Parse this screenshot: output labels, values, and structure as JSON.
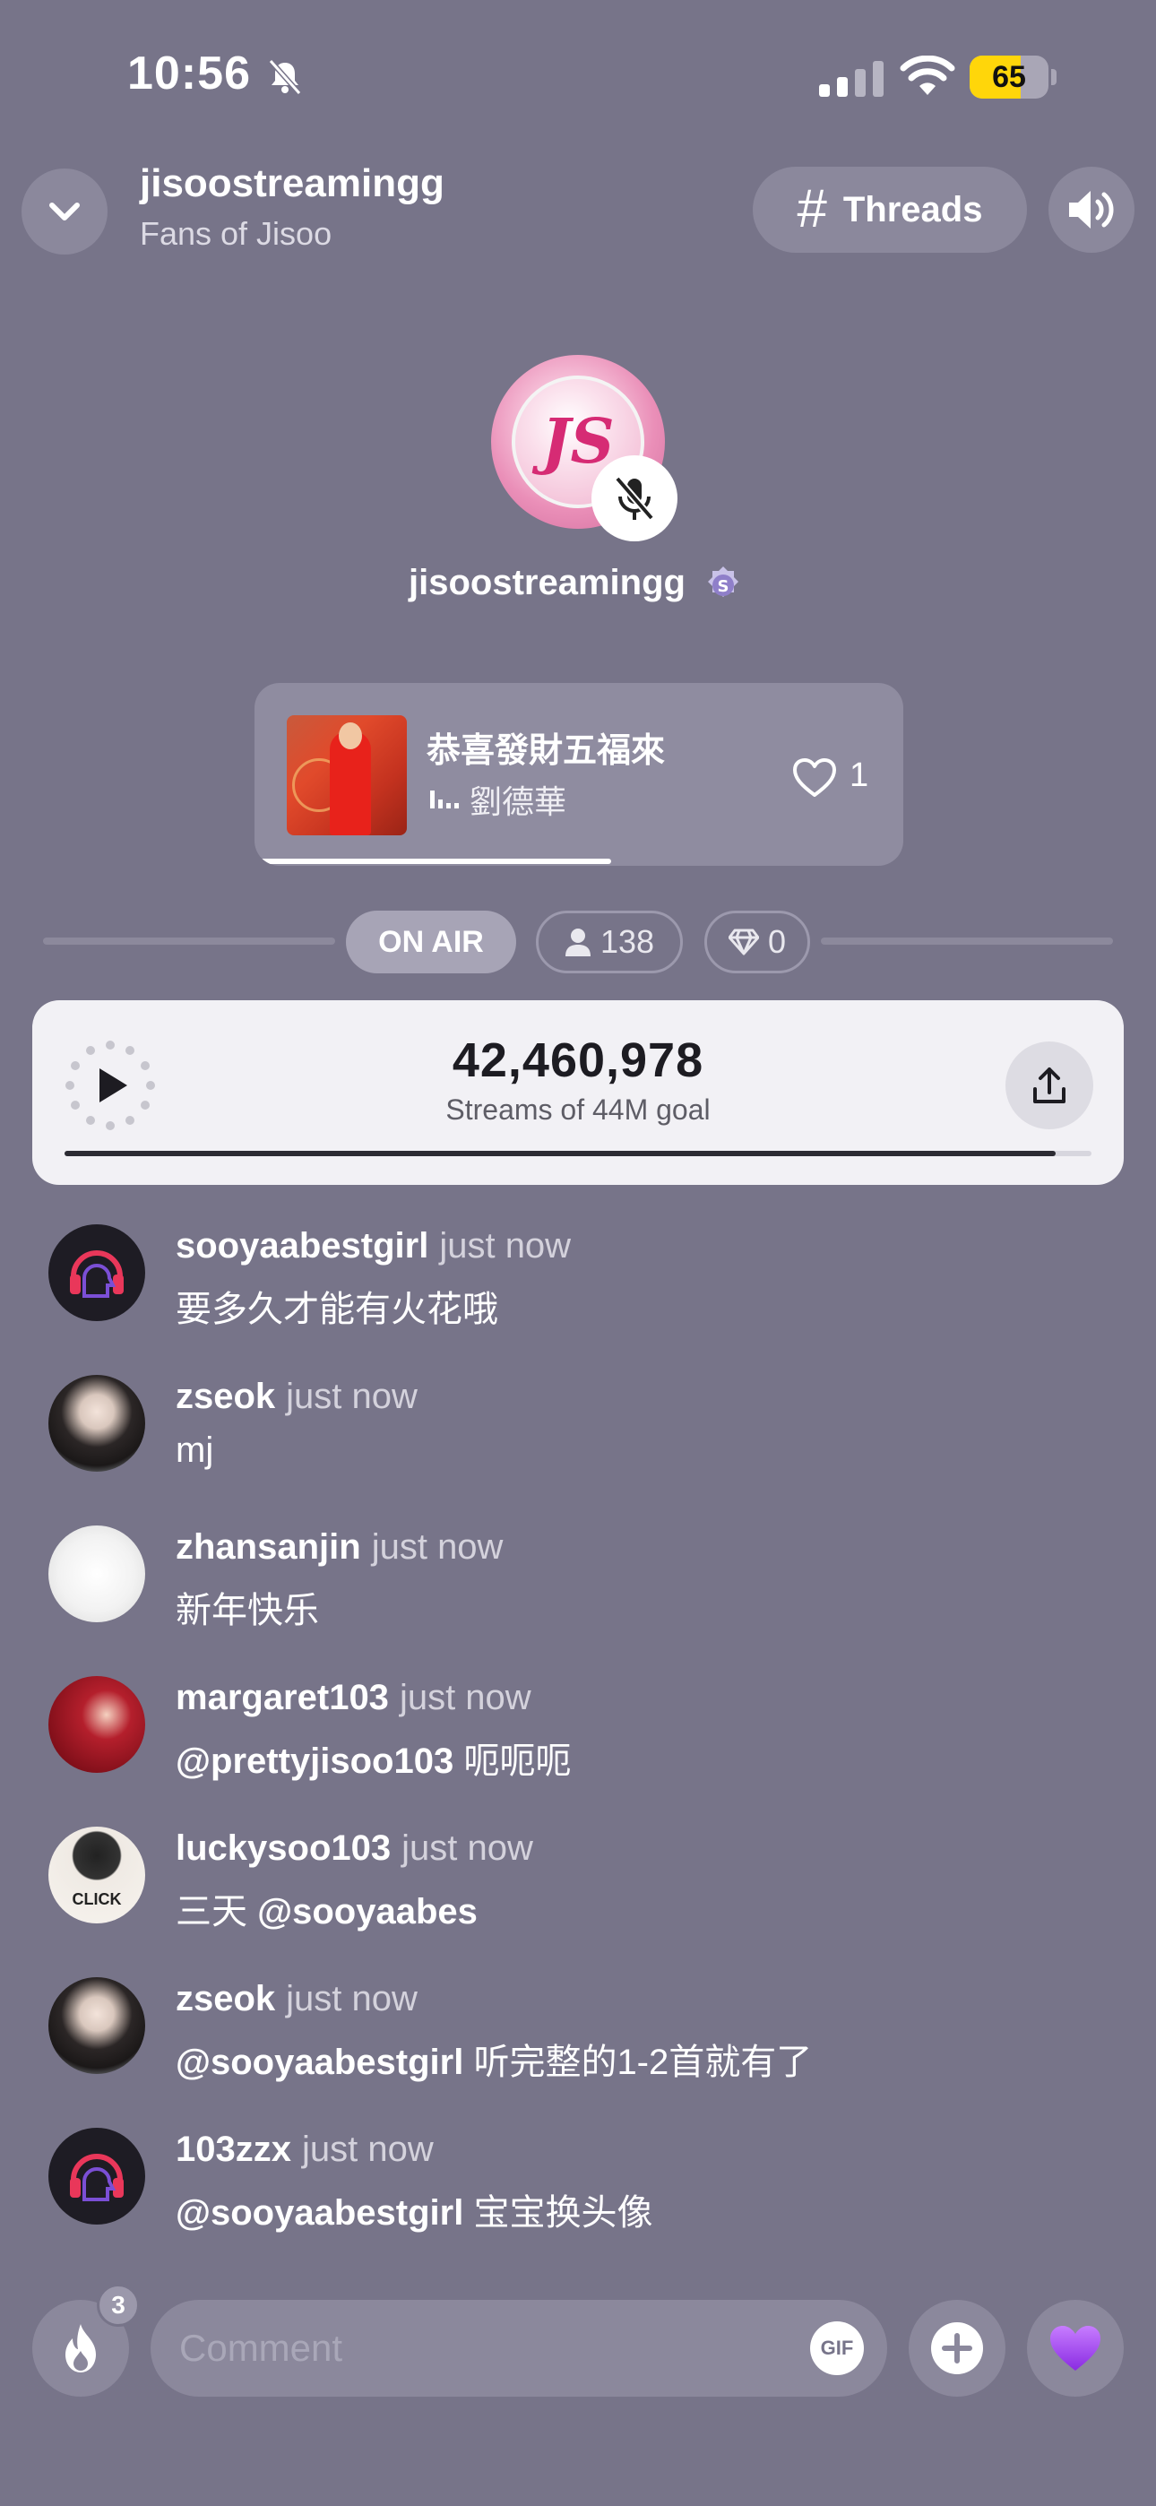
{
  "status_bar": {
    "time": "10:56",
    "battery": "65",
    "battery_level": 0.65
  },
  "header": {
    "title": "jisoostreamingg",
    "subtitle": "Fans of Jisoo",
    "threads_label": "Threads"
  },
  "host": {
    "name": "jisoostreamingg",
    "avatar_text": "JS"
  },
  "now_playing": {
    "title": "恭喜發財五福來",
    "artist": "劉德華",
    "likes": "1",
    "progress": 0.55
  },
  "room": {
    "on_air_label": "ON AIR",
    "listeners": "138",
    "gems": "0"
  },
  "stream_goal": {
    "count": "42,460,978",
    "caption": "Streams of 44M goal",
    "progress": 0.965
  },
  "chat": [
    {
      "user": "sooyaabestgirl",
      "time": "just now",
      "mention": "",
      "text": "要多久才能有火花哦"
    },
    {
      "user": "zseok",
      "time": "just now",
      "mention": "",
      "text": "mj"
    },
    {
      "user": "zhansanjin",
      "time": "just now",
      "mention": "",
      "text": "新年快乐"
    },
    {
      "user": "margaret103",
      "time": "just now",
      "mention": "@prettyjisoo103",
      "text": " 呃呃呃"
    },
    {
      "user": "luckysoo103",
      "time": "just now",
      "mention": "@sooyaabes",
      "text": "三天 "
    },
    {
      "user": "zseok",
      "time": "just now",
      "mention": "@sooyaabestgirl",
      "text": " 听完整的1-2首就有了"
    },
    {
      "user": "103zzx",
      "time": "just now",
      "mention": "@sooyaabestgirl",
      "text": " 宝宝换头像"
    }
  ],
  "composer": {
    "placeholder": "Comment",
    "gif_label": "GIF",
    "fire_count": "3"
  },
  "colors": {
    "background": "#777489",
    "accent_yellow": "#ffd60a",
    "heart_purple": "#b15cf0"
  },
  "icons": [
    "bell-slash-icon",
    "cellular-signal-icon",
    "wifi-icon",
    "chevron-down-icon",
    "hashtag-icon",
    "speaker-icon",
    "mic-off-icon",
    "verified-badge-icon",
    "equalizer-icon",
    "heart-outline-icon",
    "person-icon",
    "diamond-icon",
    "play-icon",
    "share-icon",
    "fire-icon",
    "plus-icon",
    "purple-heart-icon"
  ]
}
